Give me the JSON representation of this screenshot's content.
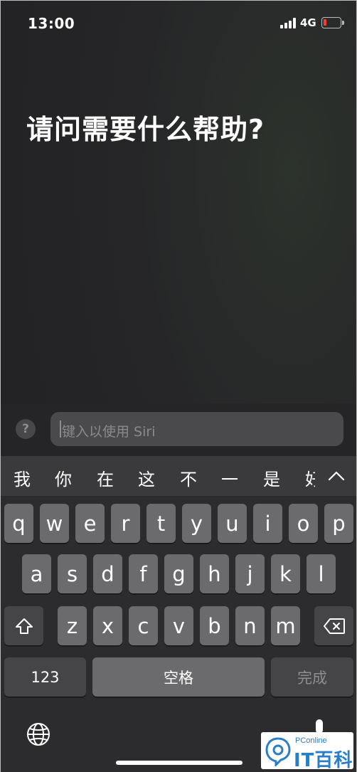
{
  "status_bar": {
    "time": "13:00",
    "network": "4G"
  },
  "siri": {
    "prompt": "请问需要什么帮助?"
  },
  "input": {
    "help_label": "?",
    "placeholder": "键入以使用 Siri"
  },
  "candidates": [
    "我",
    "你",
    "在",
    "这",
    "不",
    "一",
    "是",
    "好"
  ],
  "keyboard": {
    "row1": [
      "q",
      "w",
      "e",
      "r",
      "t",
      "y",
      "u",
      "i",
      "o",
      "p"
    ],
    "row2": [
      "a",
      "s",
      "d",
      "f",
      "g",
      "h",
      "j",
      "k",
      "l"
    ],
    "row3": [
      "z",
      "x",
      "c",
      "v",
      "b",
      "n",
      "m"
    ],
    "numbers_label": "123",
    "space_label": "空格",
    "done_label": "完成"
  },
  "watermark": {
    "brand_small": "PConline",
    "brand_big": "IT百科"
  },
  "colors": {
    "battery_low": "#ff3b30",
    "watermark_blue": "#2a7ec8"
  }
}
